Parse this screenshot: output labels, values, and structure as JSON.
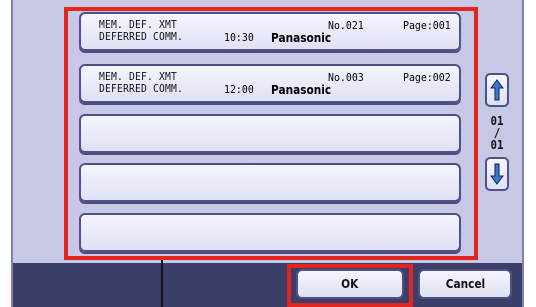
{
  "jobs": [
    {
      "desc1": "MEM. DEF. XMT",
      "desc2": "DEFERRED COMM.",
      "no": "No.021",
      "page": "Page:001",
      "time": "10:30",
      "sender": "Panasonic"
    },
    {
      "desc1": "MEM. DEF. XMT",
      "desc2": "DEFERRED COMM.",
      "no": "No.003",
      "page": "Page:002",
      "time": "12:00",
      "sender": "Panasonic"
    },
    {
      "desc1": "",
      "desc2": "",
      "no": "",
      "page": "",
      "time": "",
      "sender": ""
    },
    {
      "desc1": "",
      "desc2": "",
      "no": "",
      "page": "",
      "time": "",
      "sender": ""
    },
    {
      "desc1": "",
      "desc2": "",
      "no": "",
      "page": "",
      "time": "",
      "sender": ""
    }
  ],
  "pager": {
    "current": "01",
    "separator": "/",
    "total": "01"
  },
  "buttons": {
    "ok": "OK",
    "cancel": "Cancel"
  },
  "colors": {
    "panel": "#c6c8e6",
    "bar": "#3b3e68",
    "highlight": "#e2251d",
    "button_border": "#4f5287"
  },
  "icons": {
    "up": "arrow-up-icon",
    "down": "arrow-down-icon"
  }
}
